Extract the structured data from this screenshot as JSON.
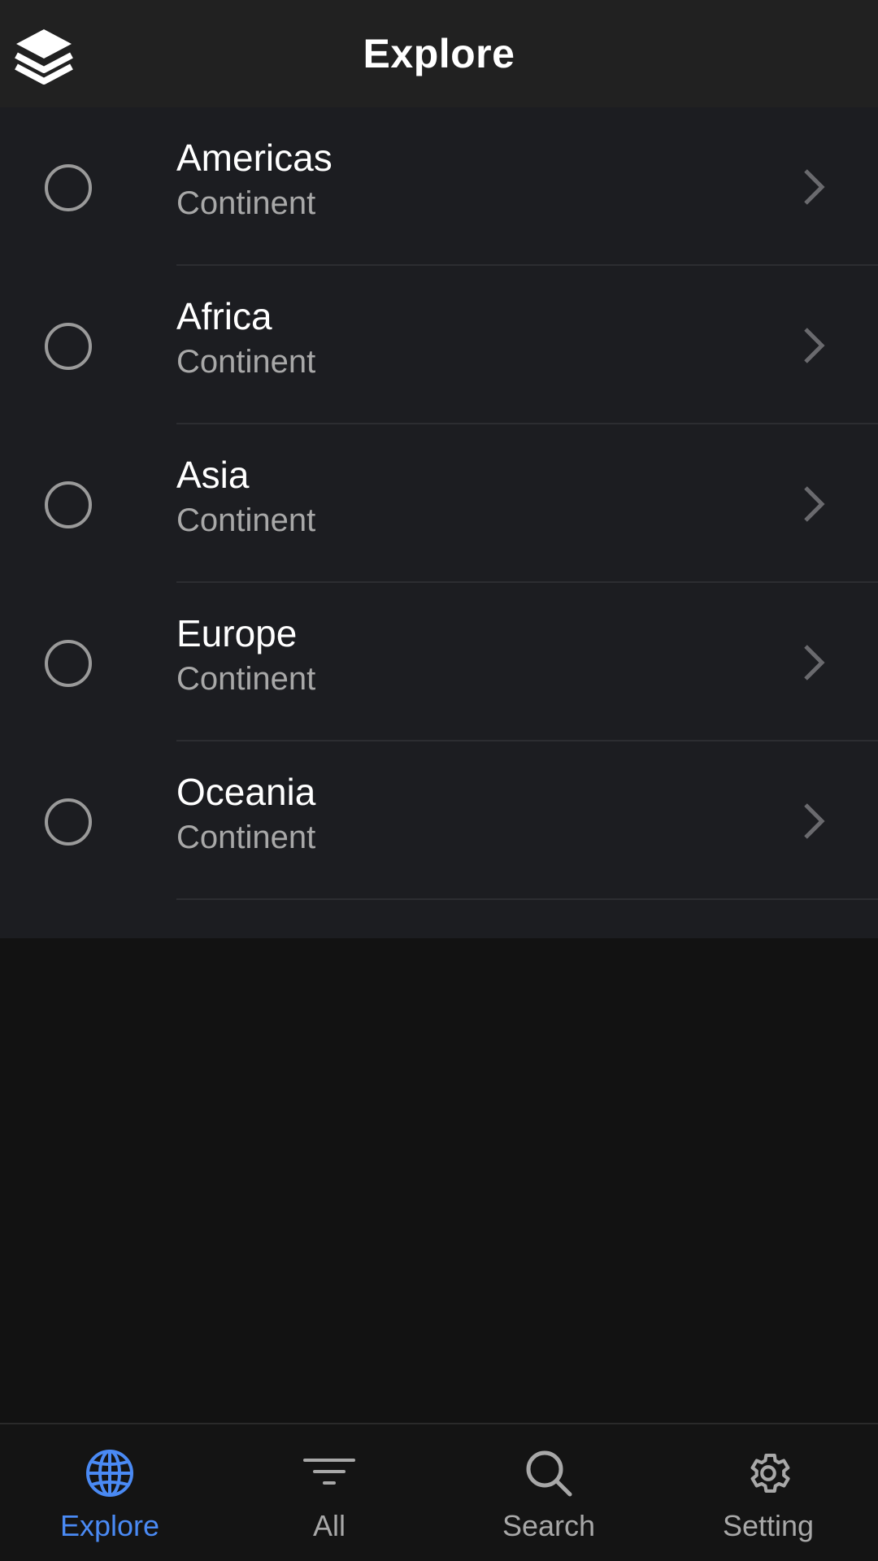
{
  "header": {
    "title": "Explore"
  },
  "list": {
    "items": [
      {
        "name": "Americas",
        "subtitle": "Continent"
      },
      {
        "name": "Africa",
        "subtitle": "Continent"
      },
      {
        "name": "Asia",
        "subtitle": "Continent"
      },
      {
        "name": "Europe",
        "subtitle": "Continent"
      },
      {
        "name": "Oceania",
        "subtitle": "Continent"
      }
    ]
  },
  "bottom_nav": {
    "items": [
      {
        "label": "Explore",
        "icon": "globe-icon",
        "active": true
      },
      {
        "label": "All",
        "icon": "filter-icon",
        "active": false
      },
      {
        "label": "Search",
        "icon": "search-icon",
        "active": false
      },
      {
        "label": "Setting",
        "icon": "gear-icon",
        "active": false
      }
    ]
  },
  "colors": {
    "accent": "#4a8af4",
    "header_bg": "#212121",
    "list_bg": "#1c1d21",
    "page_bg": "#121212",
    "secondary_text": "#a8a8a8"
  }
}
